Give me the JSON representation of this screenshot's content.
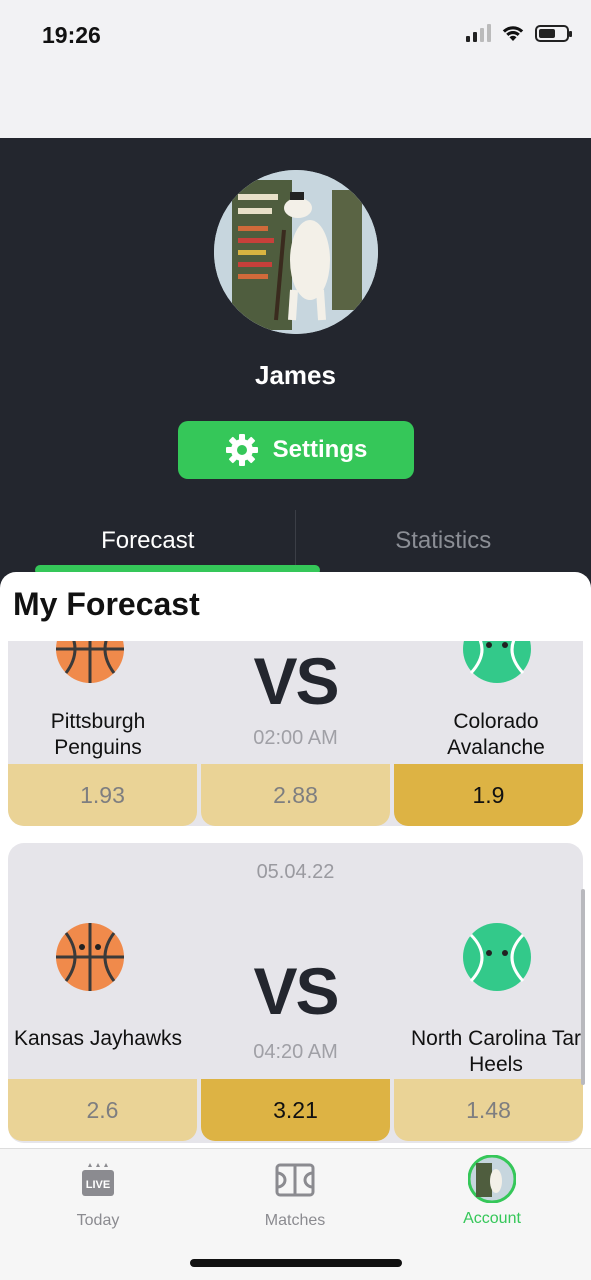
{
  "status_bar": {
    "time": "19:26"
  },
  "profile": {
    "name": "James",
    "settings_label": "Settings"
  },
  "tabs": [
    {
      "label": "Forecast",
      "active": true
    },
    {
      "label": "Statistics",
      "active": false
    }
  ],
  "sheet": {
    "title": "My Forecast"
  },
  "matches": [
    {
      "date": "",
      "home": {
        "name": "Pittsburgh Penguins",
        "icon": "basketball-icon"
      },
      "away": {
        "name": "Colorado Avalanche",
        "icon": "tennis-ball-icon"
      },
      "vs": "VS",
      "time": "02:00 AM",
      "odds": [
        "1.93",
        "2.88",
        "1.9"
      ],
      "selected": 2
    },
    {
      "date": "05.04.22",
      "home": {
        "name": "Kansas Jayhawks",
        "icon": "basketball-icon"
      },
      "away": {
        "name": "North Carolina Tar Heels",
        "icon": "tennis-ball-icon"
      },
      "vs": "VS",
      "time": "04:20 AM",
      "odds": [
        "2.6",
        "3.21",
        "1.48"
      ],
      "selected": 1
    }
  ],
  "tabbar": {
    "items": [
      {
        "label": "Today",
        "icon": "live-tv-icon",
        "badge": "LIVE"
      },
      {
        "label": "Matches",
        "icon": "court-icon"
      },
      {
        "label": "Account",
        "icon": "avatar-icon",
        "active": true
      }
    ]
  },
  "colors": {
    "accent": "#35c759",
    "background": "#23262e",
    "odd_default": "#ead396",
    "odd_selected": "#ddb344"
  }
}
